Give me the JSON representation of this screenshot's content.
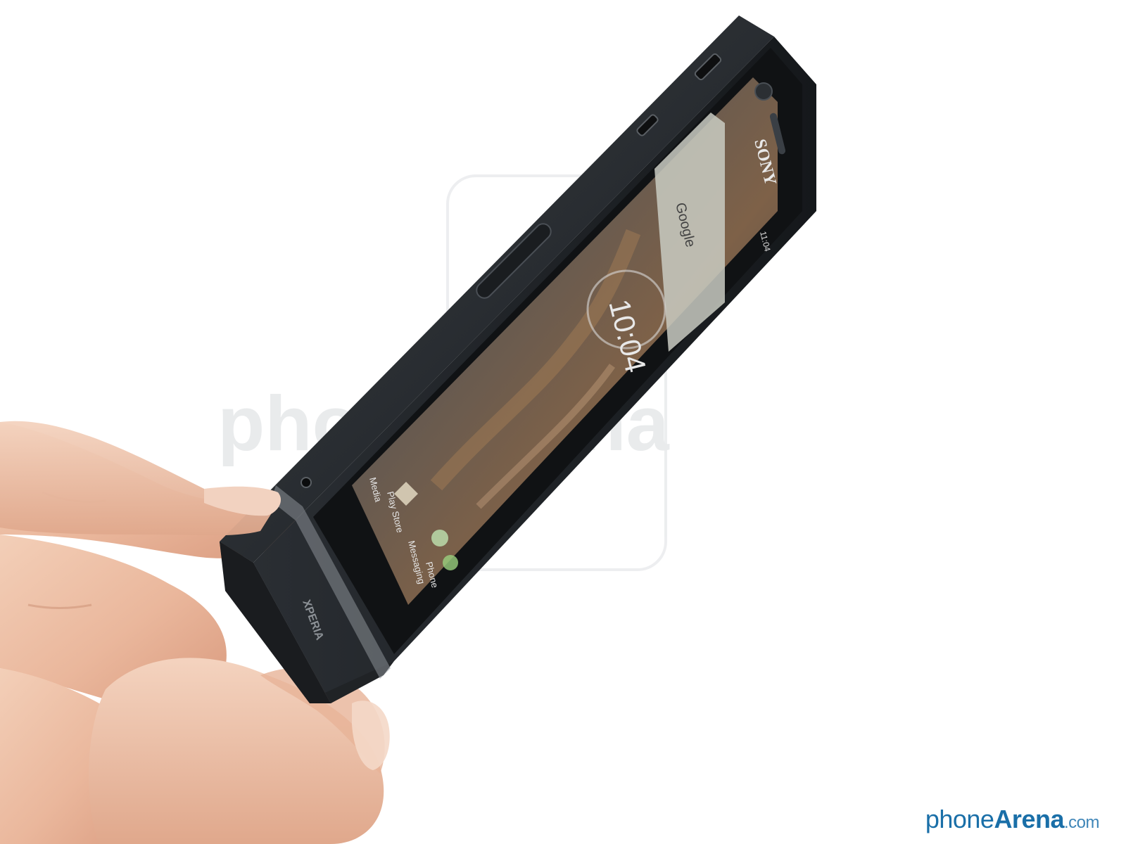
{
  "photo": {
    "watermark_center": "phoneArena",
    "brand_logo": "SONY",
    "series_logo": "XPERIA",
    "screen": {
      "status_time": "11:04",
      "search_widget": "Google",
      "clock_widget": "10:04",
      "dock_labels": [
        "Media",
        "Play Store",
        "Messaging",
        "Phone"
      ]
    }
  },
  "site_watermark": {
    "part1": "phone",
    "part2": "Arena",
    "part3": ".com"
  },
  "colors": {
    "phone_body": "#1d2023",
    "background": "#ffffff",
    "skin": "#f0c7ad",
    "watermark_blue": "#1a6fa8"
  }
}
